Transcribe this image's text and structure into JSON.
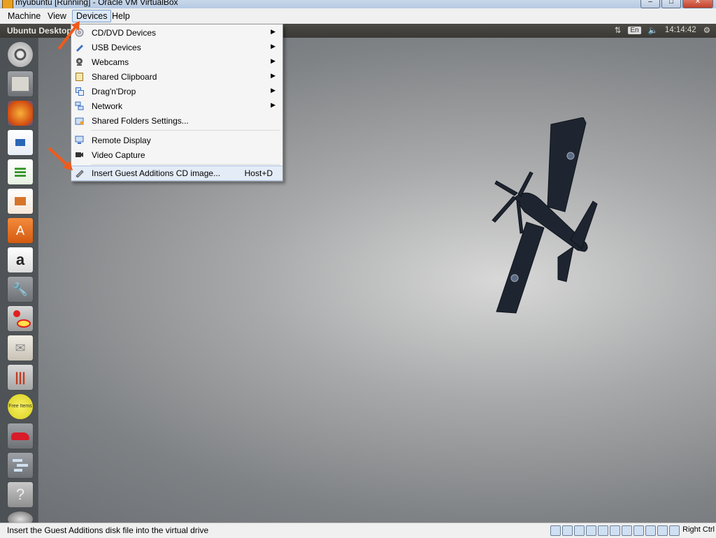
{
  "window": {
    "title": "myubuntu [Running] - Oracle VM VirtualBox",
    "buttons": {
      "minimize": "–",
      "maximize": "□",
      "close": "✕"
    }
  },
  "menubar": {
    "items": [
      "Machine",
      "View",
      "Devices",
      "Help"
    ],
    "active": "Devices"
  },
  "panel": {
    "title": "Ubuntu Desktop",
    "lang": "En",
    "clock": "14:14:42"
  },
  "launcher": {
    "icons": [
      "dash-icon",
      "files-icon",
      "firefox-icon",
      "writer-icon",
      "calc-icon",
      "impress-icon",
      "software-center-icon",
      "amazon-icon",
      "system-settings-icon",
      "diagram-app-icon",
      "mail-icon",
      "mixer-icon",
      "freemium-icon",
      "car-game-icon",
      "gantt-icon",
      "help-icon",
      "updater-icon"
    ],
    "amazon_glyph": "a",
    "help_glyph": "?",
    "freemium_text": "Free Items"
  },
  "devices_menu": {
    "items": [
      {
        "label": "CD/DVD Devices",
        "submenu": true,
        "icon": "cd-icon"
      },
      {
        "label": "USB Devices",
        "submenu": true,
        "icon": "usb-icon"
      },
      {
        "label": "Webcams",
        "submenu": true,
        "icon": "webcam-icon"
      },
      {
        "label": "Shared Clipboard",
        "submenu": true,
        "icon": "clipboard-icon"
      },
      {
        "label": "Drag'n'Drop",
        "submenu": true,
        "icon": "dragdrop-icon"
      },
      {
        "label": "Network",
        "submenu": true,
        "icon": "network-icon"
      },
      {
        "label": "Shared Folders Settings...",
        "submenu": false,
        "icon": "shared-folder-icon"
      },
      {
        "label": "Remote Display",
        "submenu": false,
        "icon": "remote-display-icon"
      },
      {
        "label": "Video Capture",
        "submenu": false,
        "icon": "video-capture-icon"
      },
      {
        "label": "Insert Guest Additions CD image...",
        "submenu": false,
        "icon": "guest-additions-icon",
        "shortcut": "Host+D"
      }
    ],
    "submenu_arrow": "▶"
  },
  "statusbar": {
    "text": "Insert the Guest Additions disk file into the virtual drive",
    "host_key": "Right Ctrl"
  },
  "colors": {
    "annotation_arrow": "#f05a1a",
    "menu_highlight": "#e4ecf7"
  }
}
